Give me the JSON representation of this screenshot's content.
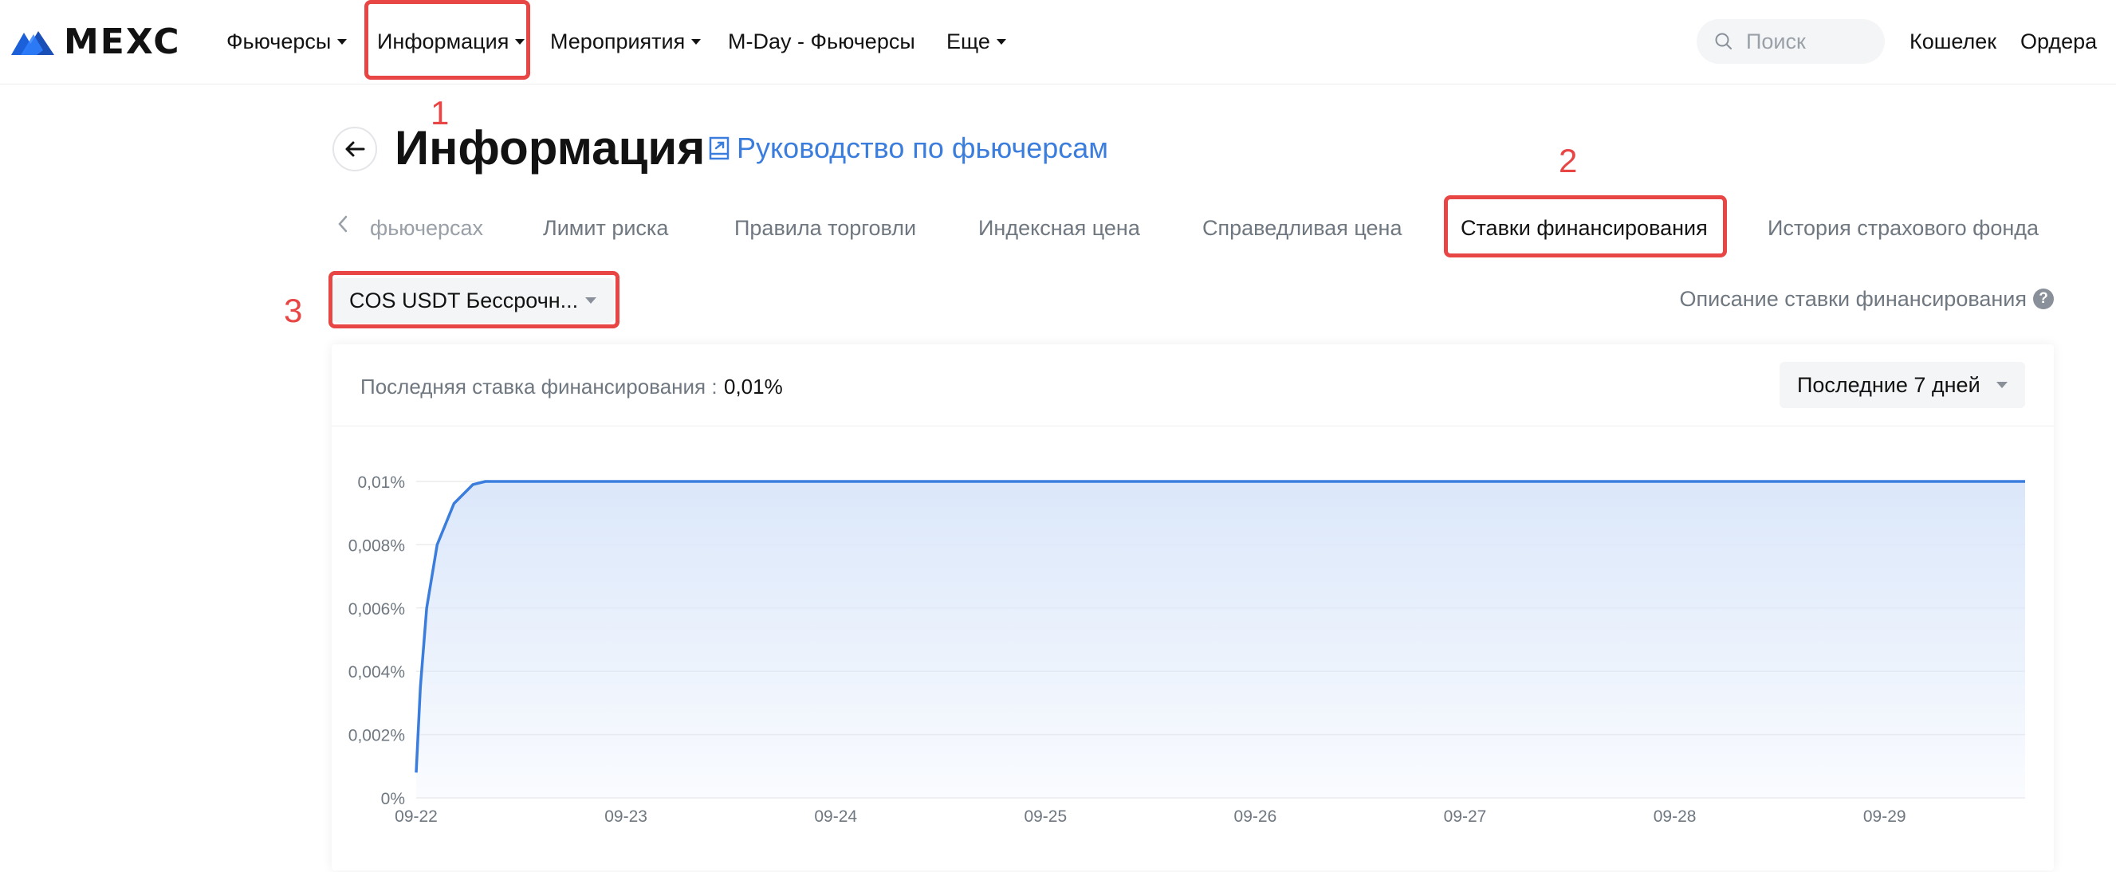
{
  "brand": {
    "logo_text": "MEXC",
    "accent": "#3b7ddd",
    "annotation_color": "#e84545"
  },
  "nav": {
    "items": [
      {
        "label": "Фьючерсы",
        "has_caret": true
      },
      {
        "label": "Информация",
        "has_caret": true
      },
      {
        "label": "Мероприятия",
        "has_caret": true
      },
      {
        "label": "M-Day - Фьючерсы",
        "has_caret": false
      },
      {
        "label": "Еще",
        "has_caret": true
      }
    ],
    "search_placeholder": "Поиск",
    "wallet": "Кошелек",
    "orders": "Ордера"
  },
  "annotations": {
    "n1": "1",
    "n2": "2",
    "n3": "3"
  },
  "header": {
    "title": "Информация",
    "guide_link": "Руководство по фьючерсам"
  },
  "tabs": [
    {
      "label": "фьючерсах",
      "state": "faded"
    },
    {
      "label": "Лимит риска",
      "state": "normal"
    },
    {
      "label": "Правила торговли",
      "state": "normal"
    },
    {
      "label": "Индексная цена",
      "state": "normal"
    },
    {
      "label": "Справедливая цена",
      "state": "normal"
    },
    {
      "label": "Ставки финансирования",
      "state": "active"
    },
    {
      "label": "История страхового фонда",
      "state": "normal"
    }
  ],
  "symbol_select": {
    "value": "COS USDT Бессрочн..."
  },
  "funding_desc_link": "Описание ставки финансирования",
  "card": {
    "latest_label": "Последняя ставка финансирования :",
    "latest_value": "0,01%",
    "period": "Последние 7 дней"
  },
  "chart_data": {
    "type": "area",
    "x": [
      "09-22",
      "09-22",
      "09-22",
      "09-22",
      "09-22",
      "09-22",
      "09-22",
      "09-23",
      "09-24",
      "09-25",
      "09-26",
      "09-27",
      "09-28",
      "09-29",
      "09-29"
    ],
    "x_numeric_days": [
      0,
      0.02,
      0.05,
      0.1,
      0.18,
      0.27,
      0.33,
      1,
      2,
      3,
      4,
      5,
      6,
      7,
      7.67
    ],
    "y": [
      0.0008,
      0.0035,
      0.006,
      0.008,
      0.0093,
      0.0099,
      0.01,
      0.01,
      0.01,
      0.01,
      0.01,
      0.01,
      0.01,
      0.01,
      0.01
    ],
    "x_ticks": [
      "09-22",
      "09-23",
      "09-24",
      "09-25",
      "09-26",
      "09-27",
      "09-28",
      "09-29"
    ],
    "y_ticks": [
      "0%",
      "0,002%",
      "0,004%",
      "0,006%",
      "0,008%",
      "0,01%"
    ],
    "ylim": [
      0,
      0.01
    ],
    "grid": true,
    "line_color": "#3b7ddd",
    "fill_color": "#dbe7fa"
  }
}
